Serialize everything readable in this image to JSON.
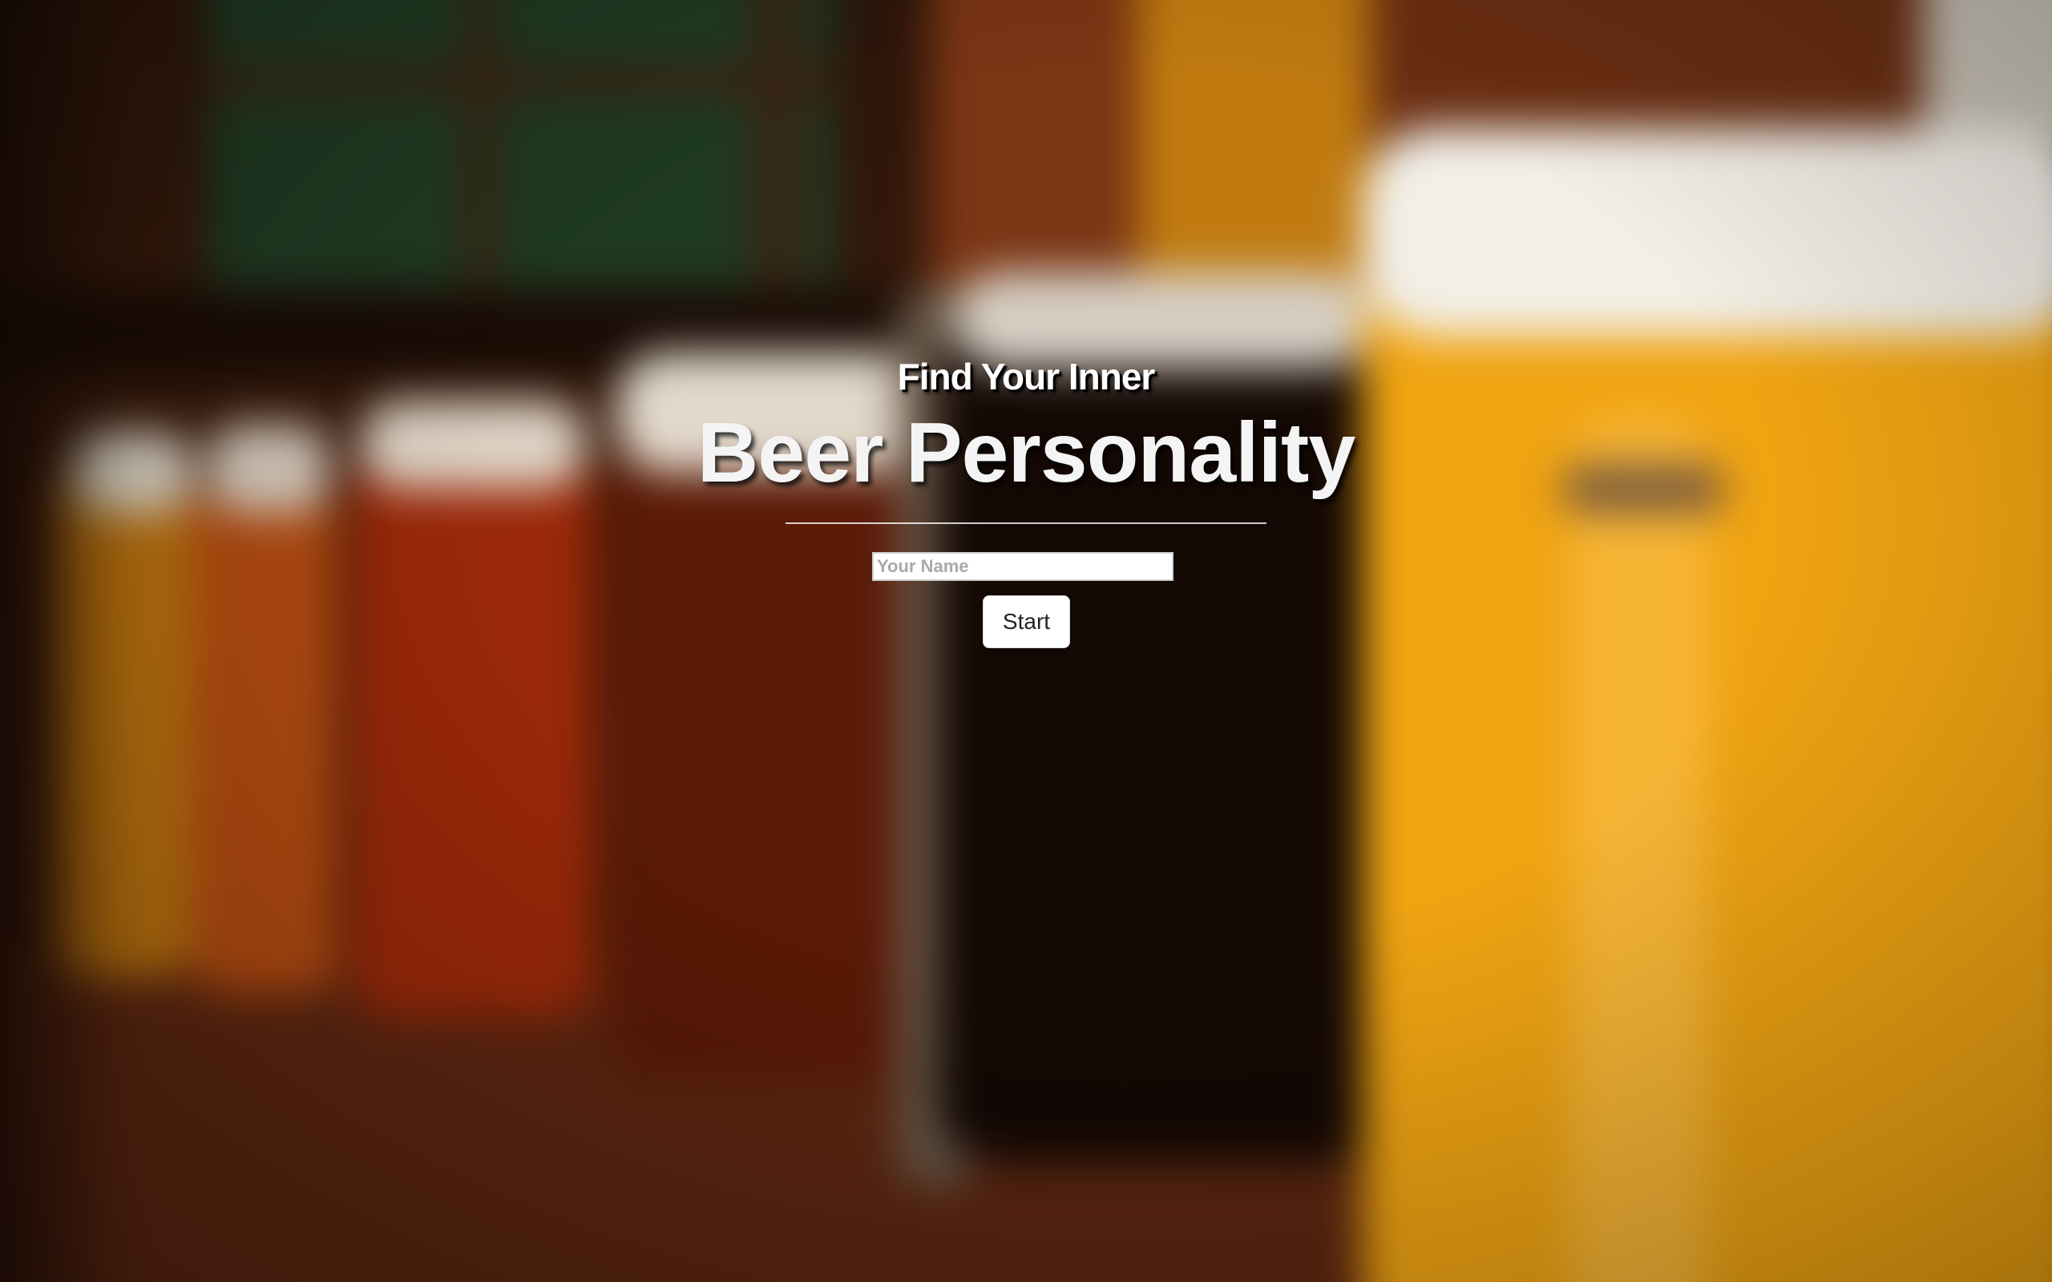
{
  "hero": {
    "eyebrow": "Find Your Inner",
    "title": "Beer Personality"
  },
  "form": {
    "name_placeholder": "Your Name",
    "name_value": "",
    "start_label": "Start"
  }
}
